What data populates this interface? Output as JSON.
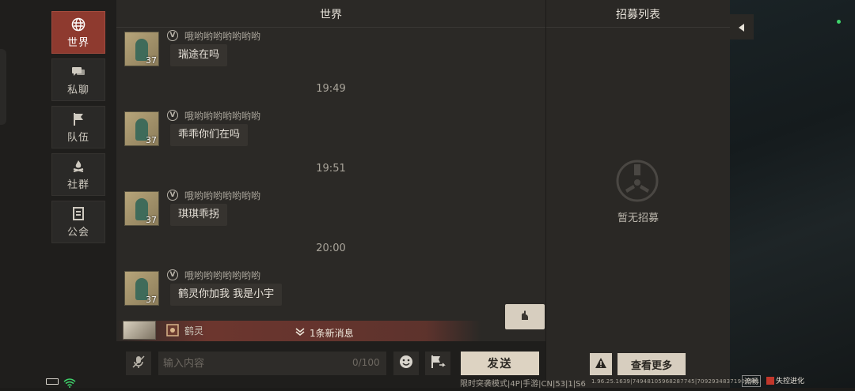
{
  "nav": {
    "items": [
      {
        "label": "世界",
        "icon": "globe-icon",
        "active": true
      },
      {
        "label": "私聊",
        "icon": "chat-bubbles-icon",
        "active": false
      },
      {
        "label": "队伍",
        "icon": "flag-icon",
        "active": false
      },
      {
        "label": "社群",
        "icon": "campfire-icon",
        "active": false
      },
      {
        "label": "公会",
        "icon": "guild-banner-icon",
        "active": false
      }
    ]
  },
  "chat": {
    "title": "世界",
    "messages": [
      {
        "username": "哦哟哟哟哟哟哟哟",
        "level": "37",
        "text": "瑞途在吗"
      },
      {
        "username": "哦哟哟哟哟哟哟哟",
        "level": "37",
        "text": "乖乖你们在吗"
      },
      {
        "username": "哦哟哟哟哟哟哟哟",
        "level": "37",
        "text": "琪琪乖拐"
      },
      {
        "username": "哦哟哟哟哟哟哟哟",
        "level": "37",
        "text": "鹤灵你加我 我是小宇"
      }
    ],
    "timestamps": [
      "19:49",
      "19:51",
      "20:00"
    ],
    "vip_badge": "V",
    "new_message": {
      "sender": "鹤灵",
      "label": "1条新消息"
    }
  },
  "input": {
    "placeholder": "输入内容",
    "value": "",
    "counter": "0/100",
    "send_label": "发送"
  },
  "recruit": {
    "title": "招募列表",
    "empty_text": "暂无招募",
    "more_label": "查看更多"
  },
  "status": {
    "mode": "限时突袭模式|4P|手游|CN|53|1|S6",
    "version": "1.96.25.1639|74948105968287745|70929348371906561",
    "quality": "流畅",
    "brand": "失控进化"
  },
  "colors": {
    "accent_active": "#8e3a2f",
    "panel": "#2b2926",
    "button_light": "#ddd3c2",
    "online_dot": "#3fd46b"
  }
}
